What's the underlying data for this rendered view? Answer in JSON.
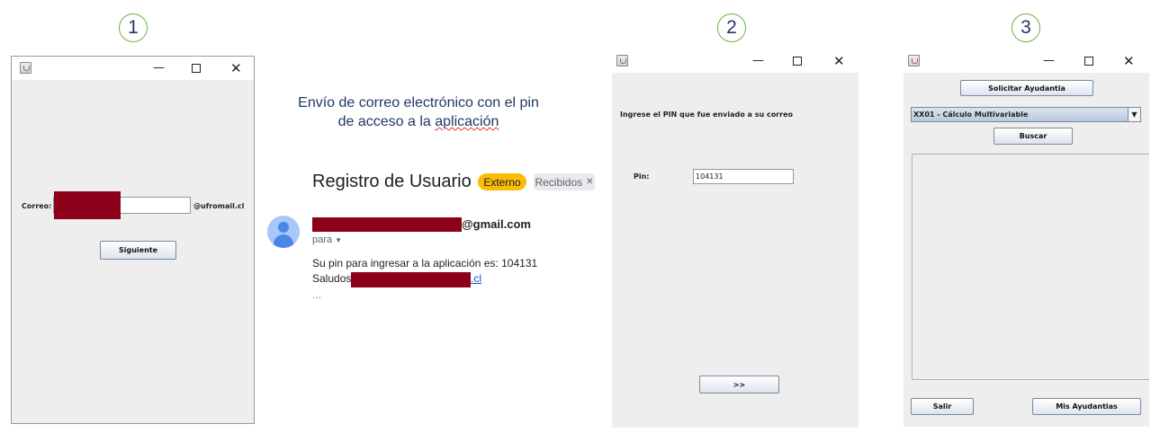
{
  "steps": [
    "1",
    "2",
    "3"
  ],
  "window1": {
    "correo_label": "Correo:",
    "domain_suffix": "@ufromail.cl",
    "next_button": "Siguiente"
  },
  "email": {
    "caption_line1": "Envío de correo electrónico con el pin",
    "caption_line2_pre": "de acceso a la ",
    "caption_line2_err": "aplicación",
    "subject": "Registro de Usuario",
    "label_externo": "Externo",
    "label_recibidos": "Recibidos",
    "sender_suffix": "@gmail.com",
    "to": "para",
    "body_line1": "Su pin para ingresar a la aplicación es: 104131",
    "body_saludos": "Saludos",
    "link_suffix": ".cl",
    "ellipsis": "..."
  },
  "window2": {
    "instruction": "Ingrese el PIN que fue enviado a su correo",
    "pin_label": "Pin:",
    "pin_value": "104131",
    "next_button": ">>"
  },
  "window3": {
    "request_button": "Solicitar Ayudantia",
    "course_selected": "XX01 - Cálculo Multivariable",
    "search_button": "Buscar",
    "exit_button": "Salir",
    "my_button": "Mis Ayudantias"
  },
  "colors": {
    "redaction": "#8c0019",
    "externo_chip": "#fbbc04",
    "recibidos_chip": "#e8eaed",
    "step_border": "#6cb33f",
    "caption_text": "#1f3864"
  }
}
